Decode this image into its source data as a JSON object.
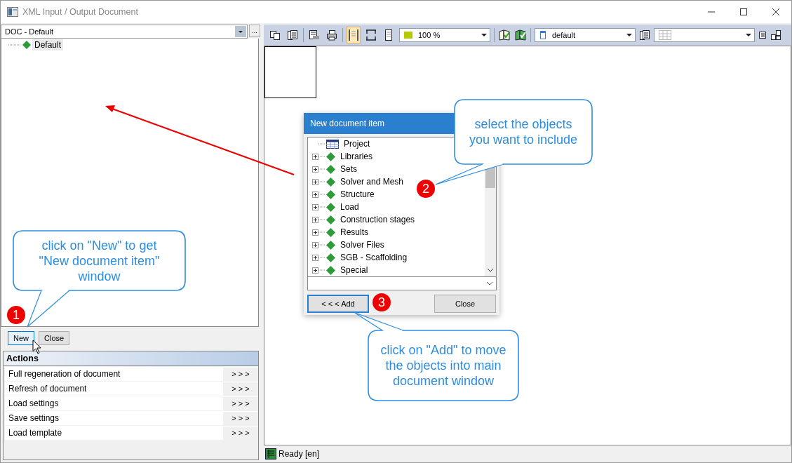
{
  "window": {
    "title": "XML Input / Output Document"
  },
  "document_selector": {
    "value": "DOC - Default",
    "browse_button": "..."
  },
  "tree": [
    {
      "label": "Default",
      "selected": true
    }
  ],
  "buttons": [
    {
      "label": "New",
      "focused": true
    },
    {
      "label": "Close",
      "focused": false
    }
  ],
  "actions": {
    "title": "Actions",
    "items": [
      {
        "label": "Full regeneration of document",
        "button": "> > >"
      },
      {
        "label": "Refresh of document",
        "button": "> > >"
      },
      {
        "label": "Load settings",
        "button": "> > >"
      },
      {
        "label": "Save settings",
        "button": "> > >"
      },
      {
        "label": "Load template",
        "button": "> > >"
      }
    ]
  },
  "toolbar": {
    "tools": [
      {
        "kind": "copy",
        "selected": false
      },
      {
        "kind": "book",
        "selected": false
      },
      {
        "kind": "sep"
      },
      {
        "kind": "preview",
        "selected": false
      },
      {
        "kind": "print",
        "selected": false
      },
      {
        "kind": "sep"
      },
      {
        "kind": "page-width",
        "selected": true
      },
      {
        "kind": "page-height",
        "selected": false
      },
      {
        "kind": "page",
        "selected": false
      }
    ],
    "zoom": "100 %",
    "style": "default"
  },
  "status_bar": {
    "text": "Ready [en]"
  },
  "dialog": {
    "title": "New document item",
    "items": [
      {
        "label": "Project",
        "kind": "table",
        "expandable": false
      },
      {
        "label": "Libraries",
        "kind": "item",
        "expandable": true
      },
      {
        "label": "Sets",
        "kind": "item",
        "expandable": true
      },
      {
        "label": "Solver and Mesh",
        "kind": "item",
        "expandable": true
      },
      {
        "label": "Structure",
        "kind": "item",
        "expandable": true
      },
      {
        "label": "Load",
        "kind": "item",
        "expandable": true
      },
      {
        "label": "Construction stages",
        "kind": "item",
        "expandable": true
      },
      {
        "label": "Results",
        "kind": "item",
        "expandable": true
      },
      {
        "label": "Solver Files",
        "kind": "item",
        "expandable": true
      },
      {
        "label": "SGB - Scaffolding",
        "kind": "item",
        "expandable": true
      },
      {
        "label": "Special",
        "kind": "item",
        "expandable": true
      }
    ],
    "buttons": [
      {
        "label": "< < < Add",
        "focused": true
      },
      {
        "label": "Close",
        "focused": false
      }
    ]
  },
  "callouts": [
    {
      "text": "click on \"New\" to get \"New document item\" window"
    },
    {
      "text": "select the objects you want to include"
    },
    {
      "text": "click on \"Add\" to move the objects into main document window"
    }
  ],
  "badges": [
    "1",
    "2",
    "3"
  ]
}
